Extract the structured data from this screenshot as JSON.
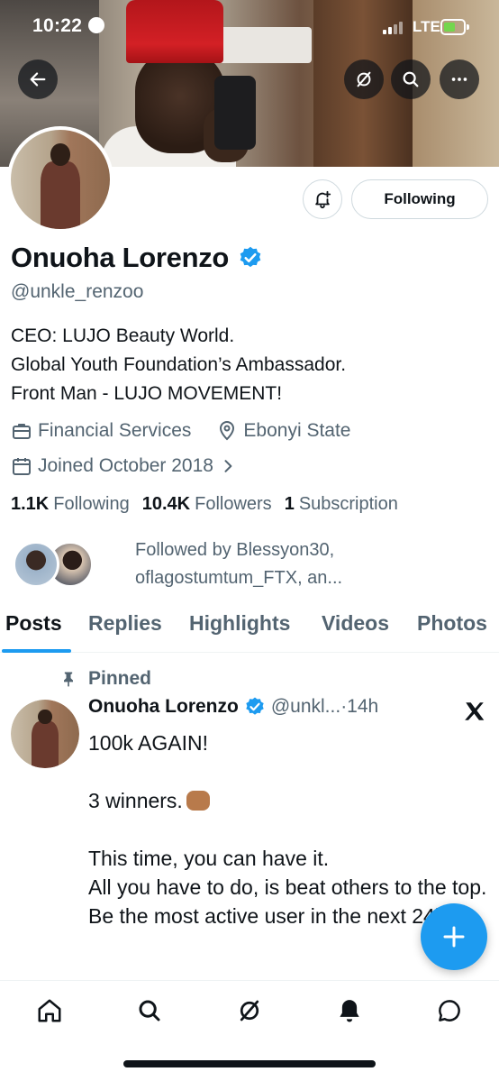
{
  "status_bar": {
    "time": "10:22",
    "network": "LTE"
  },
  "header": {
    "icons": [
      "back-arrow-icon",
      "grok-icon",
      "search-icon",
      "more-icon"
    ]
  },
  "profile": {
    "display_name": "Onuoha Lorenzo",
    "handle": "@unkle_renzoo",
    "bio_lines": [
      "CEO: LUJO Beauty World.",
      "Global Youth Foundation’s Ambassador.",
      "Front Man - LUJO MOVEMENT!"
    ],
    "category": "Financial Services",
    "location": "Ebonyi State",
    "joined": "Joined October 2018",
    "following_button": "Following",
    "stats": {
      "following_count": "1.1K",
      "following_label": "Following",
      "followers_count": "10.4K",
      "followers_label": "Followers",
      "subscriptions_count": "1",
      "subscriptions_label": "Subscription"
    },
    "followed_by_line1": "Followed by Blessyon30,",
    "followed_by_line2": "oflagostumtum_FTX, an..."
  },
  "tabs": [
    "Posts",
    "Replies",
    "Highlights",
    "Videos",
    "Photos"
  ],
  "active_tab": "Posts",
  "pinned_post": {
    "pinned_label": "Pinned",
    "author": "Onuoha Lorenzo",
    "handle": "@unkl...",
    "time": "·14h",
    "lines": {
      "l1": "100k AGAIN!",
      "l2": "3 winners.",
      "l3": "This time, you can have it.",
      "l4": "All you have to do, is beat others to the top.",
      "l5": "Be the most active user in the next 24hrs."
    }
  },
  "bottom_nav": [
    "home-icon",
    "search-icon",
    "grok-icon",
    "notifications-icon",
    "messages-icon"
  ],
  "colors": {
    "accent": "#1d9bf0",
    "text": "#0f1419",
    "secondary": "#536471",
    "border": "#cfd9de"
  }
}
